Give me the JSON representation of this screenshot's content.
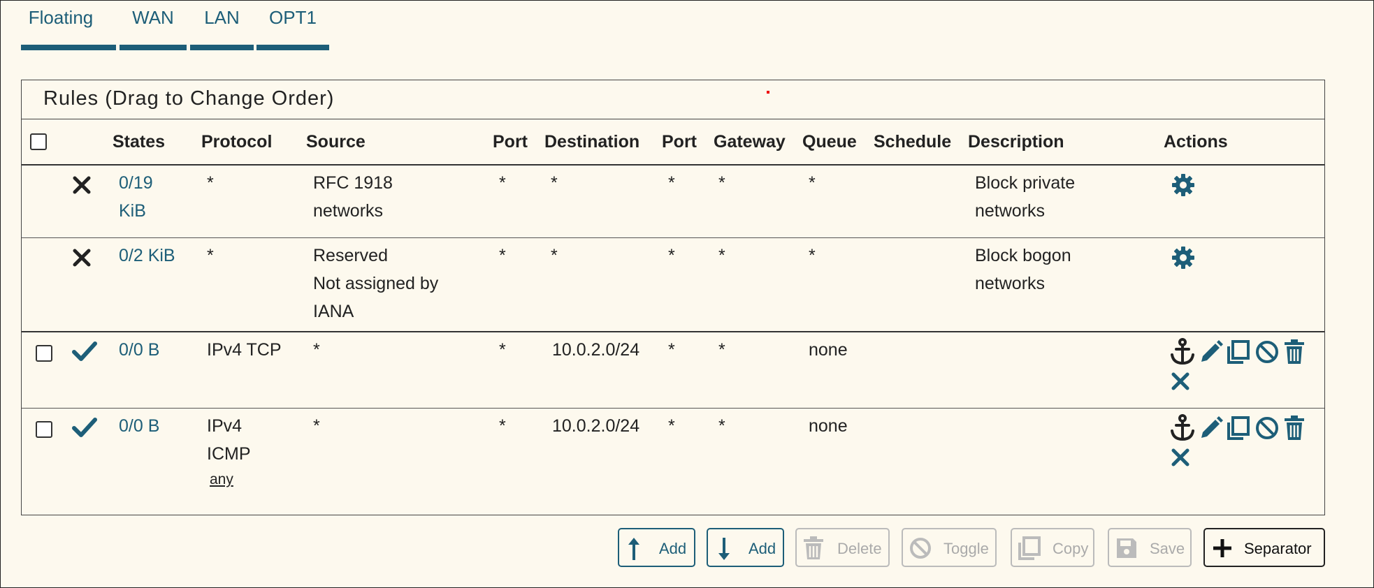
{
  "tabs": [
    {
      "label": "Floating"
    },
    {
      "label": "WAN"
    },
    {
      "label": "LAN"
    },
    {
      "label": "OPT1"
    }
  ],
  "panel": {
    "title": "Rules (Drag to Change Order)"
  },
  "columns": {
    "states": "States",
    "protocol": "Protocol",
    "source": "Source",
    "port": "Port",
    "destination": "Destination",
    "port2": "Port",
    "gateway": "Gateway",
    "queue": "Queue",
    "schedule": "Schedule",
    "description": "Description",
    "actions": "Actions"
  },
  "rows": [
    {
      "status_icon": "block-x-icon",
      "states_line1": "0/19",
      "states_line2": "KiB",
      "protocol": "*",
      "source_line1": "RFC 1918",
      "source_line2": "networks",
      "port": "*",
      "destination": "*",
      "port2": "*",
      "gateway": "*",
      "queue": "*",
      "description_line1": "Block private",
      "description_line2": "networks",
      "actions": [
        "gear-icon"
      ]
    },
    {
      "status_icon": "block-x-icon",
      "states": "0/2 KiB",
      "protocol": "*",
      "source_line1": "Reserved",
      "source_line2": "Not assigned by",
      "source_line3": "IANA",
      "port": "*",
      "destination": "*",
      "port2": "*",
      "gateway": "*",
      "queue": "*",
      "description_line1": "Block bogon",
      "description_line2": "networks",
      "actions": [
        "gear-icon"
      ]
    },
    {
      "status_icon": "pass-check-icon",
      "states": "0/0 B",
      "protocol": "IPv4 TCP",
      "source": "*",
      "port": "*",
      "destination": "10.0.2.0/24",
      "port2": "*",
      "gateway": "*",
      "queue": "none",
      "actions": [
        "anchor-icon",
        "pencil-icon",
        "copy-icon",
        "disable-icon",
        "trash-icon",
        "delete-x-icon"
      ]
    },
    {
      "status_icon": "pass-check-icon",
      "states": "0/0 B",
      "protocol_line1": "IPv4",
      "protocol_line2": "ICMP",
      "protocol_line3": "any",
      "source": "*",
      "port": "*",
      "destination": "10.0.2.0/24",
      "port2": "*",
      "gateway": "*",
      "queue": "none",
      "actions": [
        "anchor-icon",
        "pencil-icon",
        "copy-icon",
        "disable-icon",
        "trash-icon",
        "delete-x-icon"
      ]
    }
  ],
  "buttons": {
    "add_top": "Add",
    "add_bottom": "Add",
    "delete": "Delete",
    "toggle": "Toggle",
    "copy": "Copy",
    "save": "Save",
    "separator": "Separator"
  },
  "colors": {
    "accent": "#1d5e78",
    "background": "#fdf9ee"
  }
}
